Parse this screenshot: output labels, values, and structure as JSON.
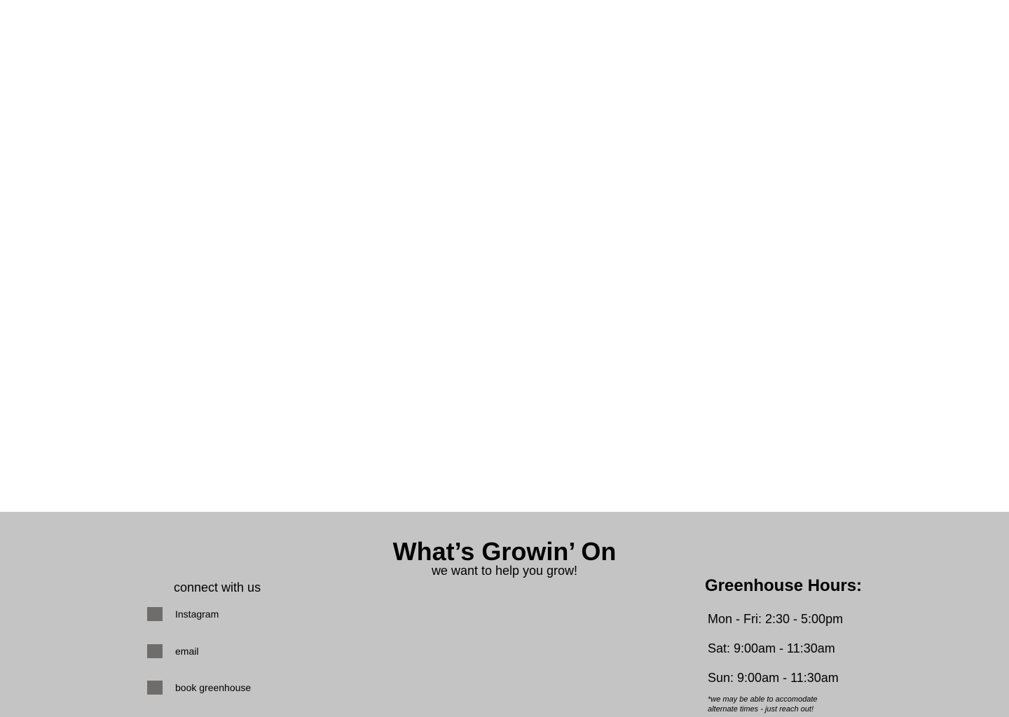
{
  "footer": {
    "brand": {
      "title": "What’s Growin’ On",
      "tagline": "we want to help you grow!"
    },
    "connect": {
      "title": "connect with us",
      "links": [
        {
          "label": "Instagram",
          "icon": "instagram-icon"
        },
        {
          "label": "email",
          "icon": "email-icon"
        },
        {
          "label": "book greenhouse",
          "icon": "calendar-icon"
        }
      ]
    },
    "hours": {
      "title": "Greenhouse Hours:",
      "rows": [
        "Mon - Fri: 2:30 - 5:00pm",
        "Sat: 9:00am - 11:30am",
        "Sun: 9:00am - 11:30am"
      ],
      "note": "*we may be able to accomodate alternate times - just reach out!"
    }
  },
  "colors": {
    "footer_background": "#c4c4c4",
    "icon_placeholder": "#6f6c6c",
    "page_background": "#ffffff"
  }
}
